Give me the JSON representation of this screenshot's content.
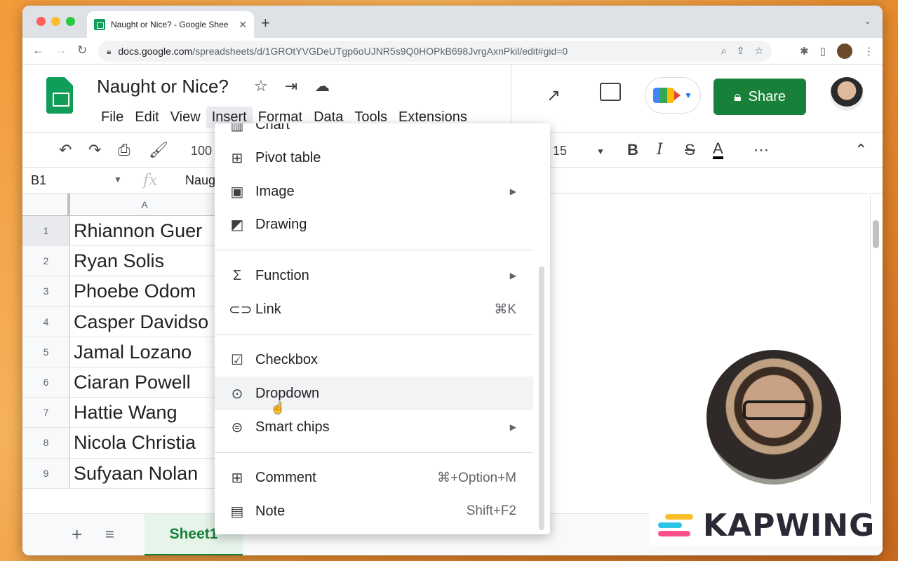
{
  "browser": {
    "tab_title": "Naught or Nice? - Google Shee",
    "url_host": "docs.google.com",
    "url_path": "/spreadsheets/d/1GROtYVGDeUTgp6oUJNR5s9Q0HOPkB698JvrgAxnPkil/edit#gid=0"
  },
  "doc": {
    "title": "Naught or Nice?",
    "share_label": "Share",
    "menus": [
      "File",
      "Edit",
      "View",
      "Insert",
      "Format",
      "Data",
      "Tools",
      "Extensions"
    ],
    "active_menu": "Insert"
  },
  "toolbar": {
    "zoom": "100",
    "font_size": "15"
  },
  "formula_bar": {
    "cell_ref": "B1",
    "fx": "fx",
    "value": "Naug"
  },
  "grid": {
    "column": "A",
    "rows": [
      {
        "num": "1",
        "value": "Rhiannon Guer"
      },
      {
        "num": "2",
        "value": "Ryan Solis"
      },
      {
        "num": "3",
        "value": "Phoebe Odom"
      },
      {
        "num": "4",
        "value": "Casper Davidso"
      },
      {
        "num": "5",
        "value": "Jamal Lozano"
      },
      {
        "num": "6",
        "value": "Ciaran Powell"
      },
      {
        "num": "7",
        "value": "Hattie Wang"
      },
      {
        "num": "8",
        "value": "Nicola Christia"
      },
      {
        "num": "9",
        "value": "Sufyaan Nolan"
      }
    ]
  },
  "insert_menu": {
    "items": [
      {
        "label": "Chart",
        "icon": "chart-icon"
      },
      {
        "label": "Pivot table",
        "icon": "pivot-table-icon"
      },
      {
        "label": "Image",
        "icon": "image-icon",
        "submenu": true
      },
      {
        "label": "Drawing",
        "icon": "drawing-icon"
      },
      {
        "label": "Function",
        "icon": "sigma-icon",
        "submenu": true
      },
      {
        "label": "Link",
        "icon": "link-icon",
        "shortcut": "⌘K"
      },
      {
        "label": "Checkbox",
        "icon": "checkbox-icon"
      },
      {
        "label": "Dropdown",
        "icon": "dropdown-icon"
      },
      {
        "label": "Smart chips",
        "icon": "smart-chips-icon",
        "submenu": true
      },
      {
        "label": "Comment",
        "icon": "comment-icon",
        "shortcut": "⌘+Option+M"
      },
      {
        "label": "Note",
        "icon": "note-icon",
        "shortcut": "Shift+F2"
      }
    ],
    "hovered": "Dropdown"
  },
  "sheets": {
    "active": "Sheet1"
  },
  "watermark": {
    "text": "KAPWING"
  },
  "colors": {
    "share_green": "#188038",
    "sheets_green": "#0f9d58",
    "menu_hover": "#f1f3f4"
  }
}
